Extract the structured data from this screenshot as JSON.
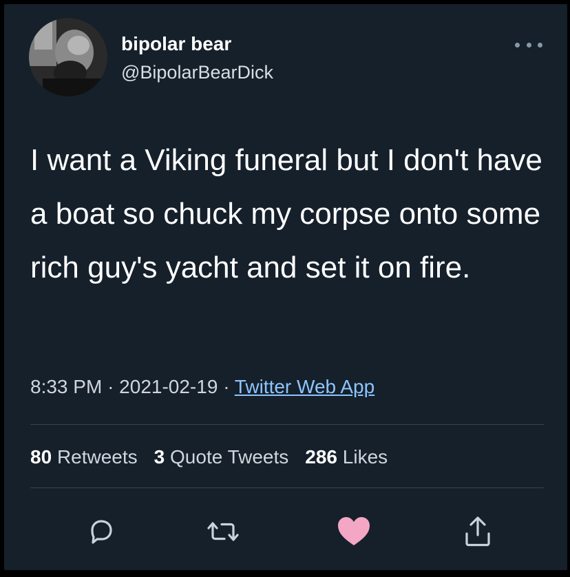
{
  "user": {
    "display_name": "bipolar bear",
    "handle": "@BipolarBearDick"
  },
  "tweet": {
    "text": "I want a Viking funeral but I don't have a boat so chuck my corpse onto some rich guy's yacht and set it on fire.",
    "time": "8:33 PM",
    "date": "2021-02-19",
    "separator": "·",
    "source": "Twitter Web App"
  },
  "stats": {
    "retweets": {
      "count": "80",
      "label": "Retweets"
    },
    "quote_tweets": {
      "count": "3",
      "label": "Quote Tweets"
    },
    "likes": {
      "count": "286",
      "label": "Likes"
    }
  },
  "icons": {
    "reply": "reply-icon",
    "retweet": "retweet-icon",
    "like": "heart-icon",
    "share": "share-icon",
    "more": "more-options-icon"
  },
  "colors": {
    "background": "#15202b",
    "link": "#8ec5ff",
    "like": "#f4a7c4",
    "icon": "#c9d3dc"
  }
}
